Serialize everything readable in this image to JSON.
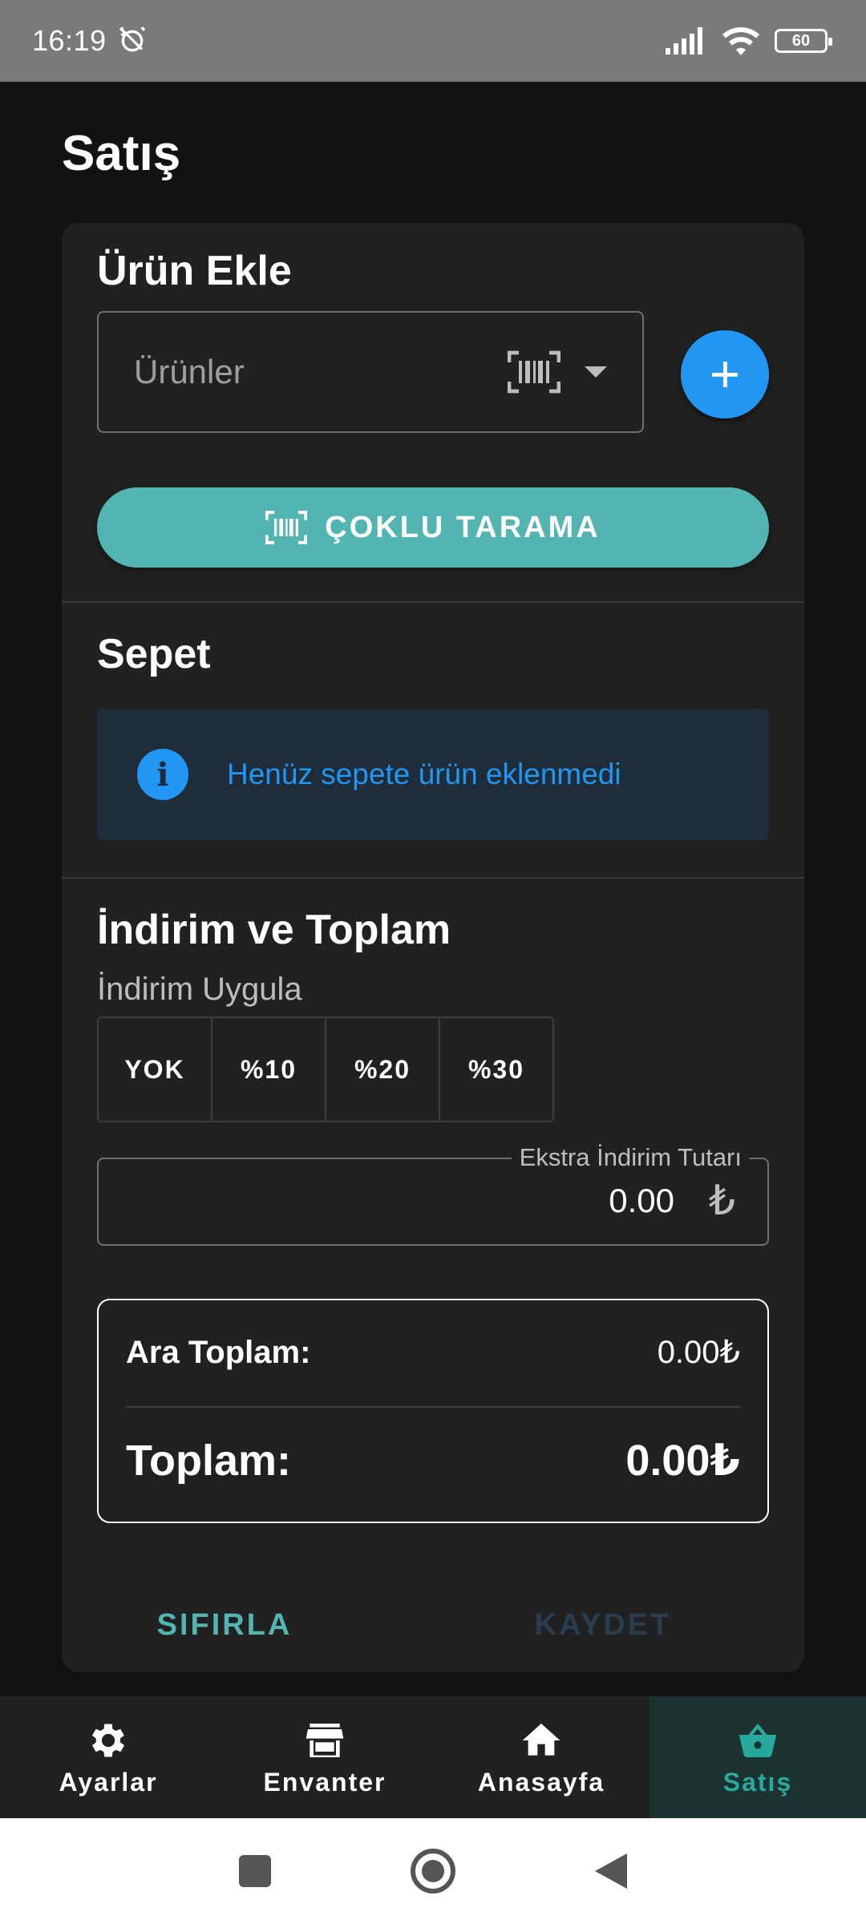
{
  "status_bar": {
    "time": "16:19",
    "battery": "60"
  },
  "page": {
    "title": "Satış"
  },
  "add_product": {
    "title": "Ürün Ekle",
    "placeholder": "Ürünler",
    "multi_scan_label": "ÇOKLU TARAMA"
  },
  "cart": {
    "title": "Sepet",
    "empty_message": "Henüz sepete ürün eklenmedi"
  },
  "discount": {
    "title": "İndirim ve Toplam",
    "apply_label": "İndirim Uygula",
    "options": [
      "YOK",
      "%10",
      "%20",
      "%30"
    ],
    "extra_label": "Ekstra İndirim Tutarı",
    "extra_value": "0.00",
    "currency_symbol": "₺"
  },
  "totals": {
    "subtotal_label": "Ara Toplam:",
    "subtotal_value": "0.00₺",
    "total_label": "Toplam:",
    "total_value": "0.00₺"
  },
  "actions": {
    "reset_label": "SIFIRLA",
    "save_label": "KAYDET"
  },
  "bottom_nav": {
    "items": [
      {
        "label": "Ayarlar",
        "icon": "gear-icon"
      },
      {
        "label": "Envanter",
        "icon": "store-icon"
      },
      {
        "label": "Anasayfa",
        "icon": "home-icon"
      },
      {
        "label": "Satış",
        "icon": "basket-icon"
      }
    ],
    "active_index": 3
  },
  "colors": {
    "accent_teal": "#53b5b1",
    "active_nav_teal": "#27a99d",
    "info_blue": "#2196f3",
    "card_bg": "#212121",
    "page_bg": "#121212"
  }
}
